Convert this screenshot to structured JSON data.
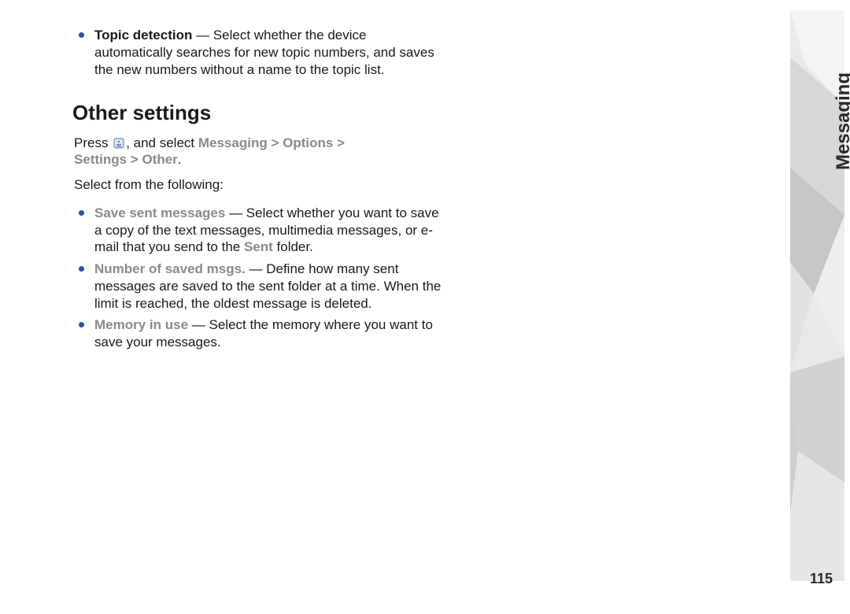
{
  "sidebar": {
    "label": "Messaging"
  },
  "page_number": "115",
  "intro_bullet": {
    "lead": "Topic detection",
    "text": " — Select whether the device automatically searches for new topic numbers, and saves the new numbers without a name to the topic list."
  },
  "heading": "Other settings",
  "nav": {
    "before_icon": "Press ",
    "after_icon": ", and select ",
    "path1": "Messaging",
    "sep": "  >  ",
    "path2": "Options",
    "path3": "Settings",
    "path4": "Other",
    "period": "."
  },
  "follow": "Select from the following:",
  "items": [
    {
      "lead": "Save sent messages",
      "before_sent": " — Select whether you want to save a copy of the text messages, multimedia messages, or e-mail that you send to the ",
      "sent_word": "Sent",
      "after_sent": " folder."
    },
    {
      "lead": "Number of saved msgs.",
      "text": " — Define how many sent messages are saved to the sent folder at a time. When the limit is reached, the oldest message is deleted."
    },
    {
      "lead": "Memory in use",
      "text": " — Select the memory where you want to save your messages."
    }
  ]
}
